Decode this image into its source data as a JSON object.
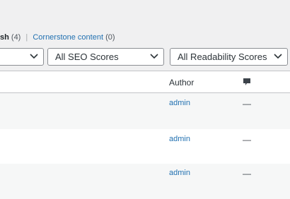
{
  "views": {
    "trash_label": "sh",
    "trash_count": "(4)",
    "separator": "|",
    "cornerstone_label": "Cornerstone content",
    "cornerstone_count": "(0)"
  },
  "filters": {
    "seo_scores": "All SEO Scores",
    "readability_scores": "All Readability Scores"
  },
  "table": {
    "columns": {
      "author": "Author",
      "comments_icon": "comment-bubble-icon"
    },
    "rows": [
      {
        "author": "admin",
        "comments": "—"
      },
      {
        "author": "admin",
        "comments": "—"
      },
      {
        "author": "admin",
        "comments": "—"
      }
    ]
  },
  "colors": {
    "link": "#2271b1",
    "background": "#f0f0f1",
    "border": "#c3c4c7"
  }
}
